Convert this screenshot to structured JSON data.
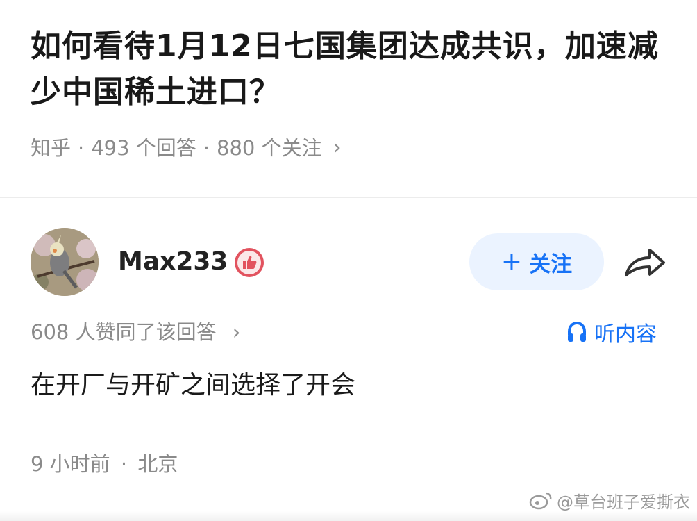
{
  "question": {
    "title": "如何看待1月12日七国集团达成共识，加速减少中国稀土进口？",
    "source": "知乎",
    "answers_count": "493 个回答",
    "followers_count": "880 个关注",
    "separator": "·",
    "chevron": "›"
  },
  "author": {
    "name": "Max233",
    "avatar_icon": "bird-avatar",
    "badge_icon": "thumb-up-badge-icon"
  },
  "actions": {
    "follow_plus": "+",
    "follow_label": "关注",
    "share_icon": "share-arrow-icon",
    "listen_label": "听内容",
    "listen_icon": "headphones-icon"
  },
  "answer": {
    "likes_text": "608 人赞同了该回答",
    "likes_chevron": "›",
    "content": "在开厂与开矿之间选择了开会",
    "time": "9 小时前",
    "separator": "·",
    "location": "北京"
  },
  "watermark": {
    "text": "@草台班子爱撕衣",
    "icon": "weibo-logo-icon"
  },
  "colors": {
    "accent": "#1772f6",
    "follow_bg": "#ebf3ff",
    "meta_gray": "#8a8a8a",
    "badge_red": "#e2535f"
  }
}
